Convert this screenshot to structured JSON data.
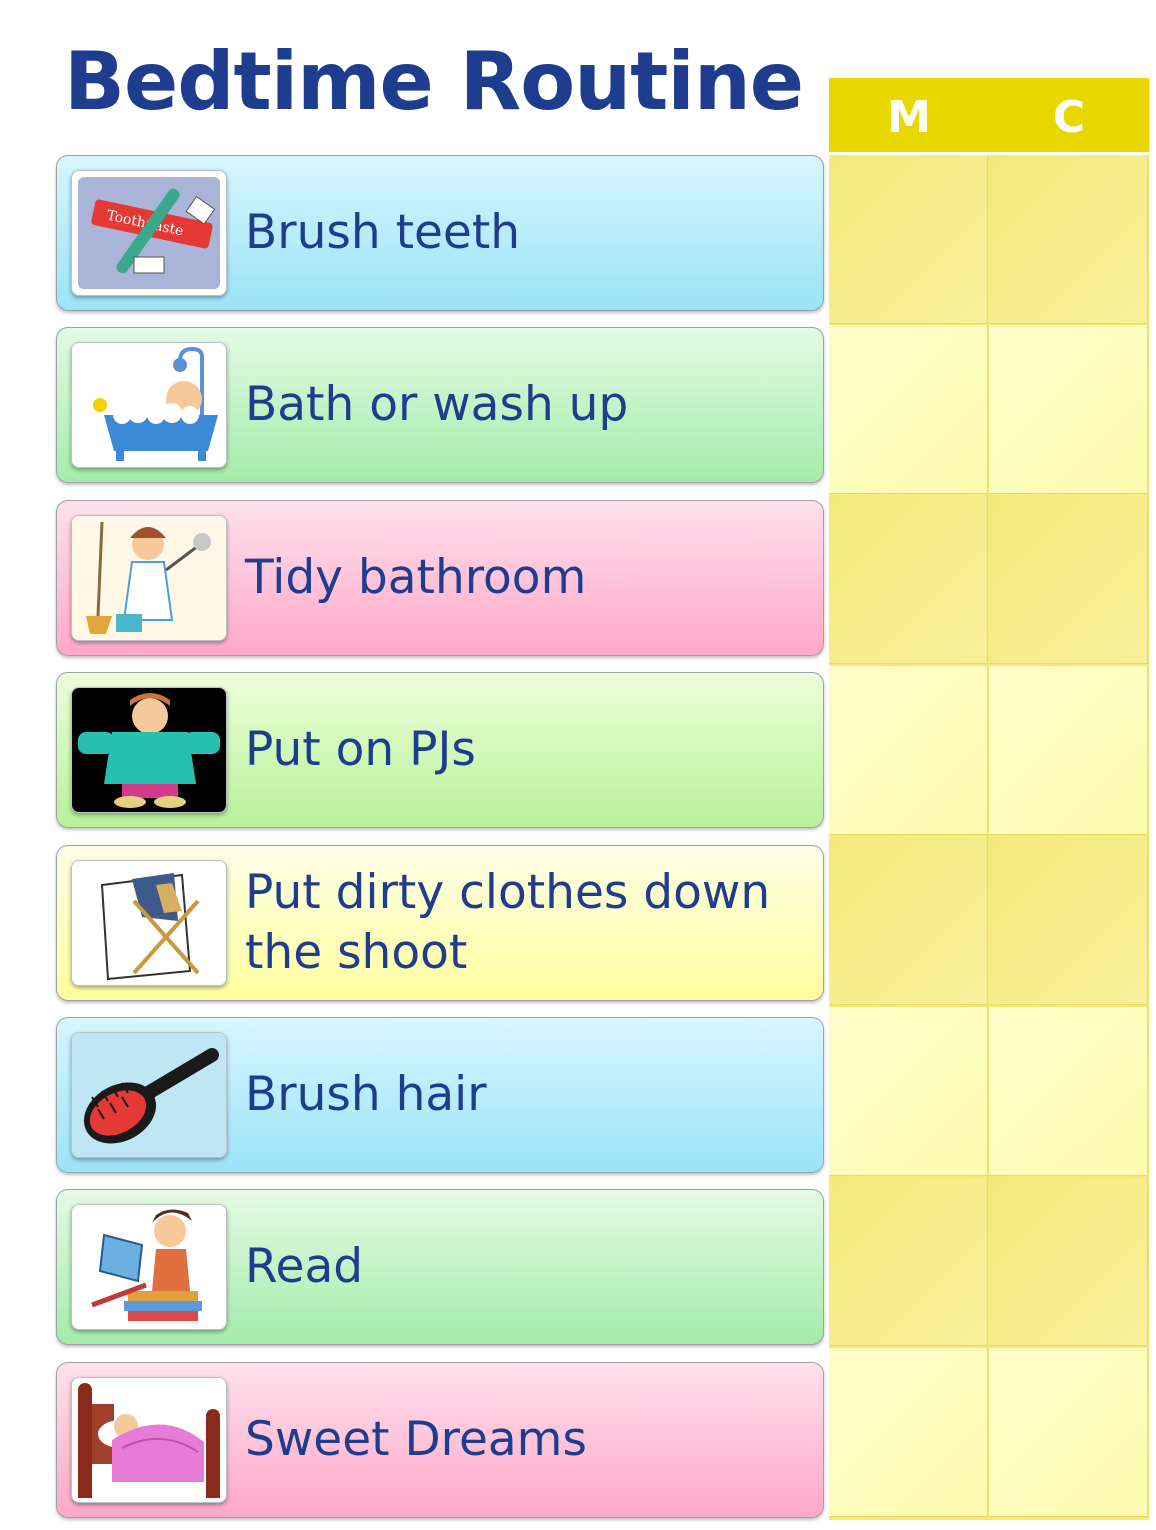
{
  "title": "Bedtime Routine",
  "columns": [
    "M",
    "C"
  ],
  "tasks": [
    {
      "label": "Brush teeth",
      "icon": "toothbrush-icon"
    },
    {
      "label": "Bath or wash up",
      "icon": "bathtub-icon"
    },
    {
      "label": "Tidy bathroom",
      "icon": "cleaning-icon"
    },
    {
      "label": "Put on PJs",
      "icon": "pajamas-icon"
    },
    {
      "label": "Put dirty clothes down the shoot",
      "icon": "laundry-hamper-icon"
    },
    {
      "label": "Brush hair",
      "icon": "hairbrush-icon"
    },
    {
      "label": "Read",
      "icon": "reading-icon"
    },
    {
      "label": "Sweet Dreams",
      "icon": "bed-icon"
    }
  ],
  "colors": {
    "title": "#1f3d8f",
    "header": "#e9d800",
    "row_blue": "#9be3f8",
    "row_green": "#a4eca8",
    "row_pink": "#ffa8c8",
    "row_yellow": "#ffff9e"
  }
}
